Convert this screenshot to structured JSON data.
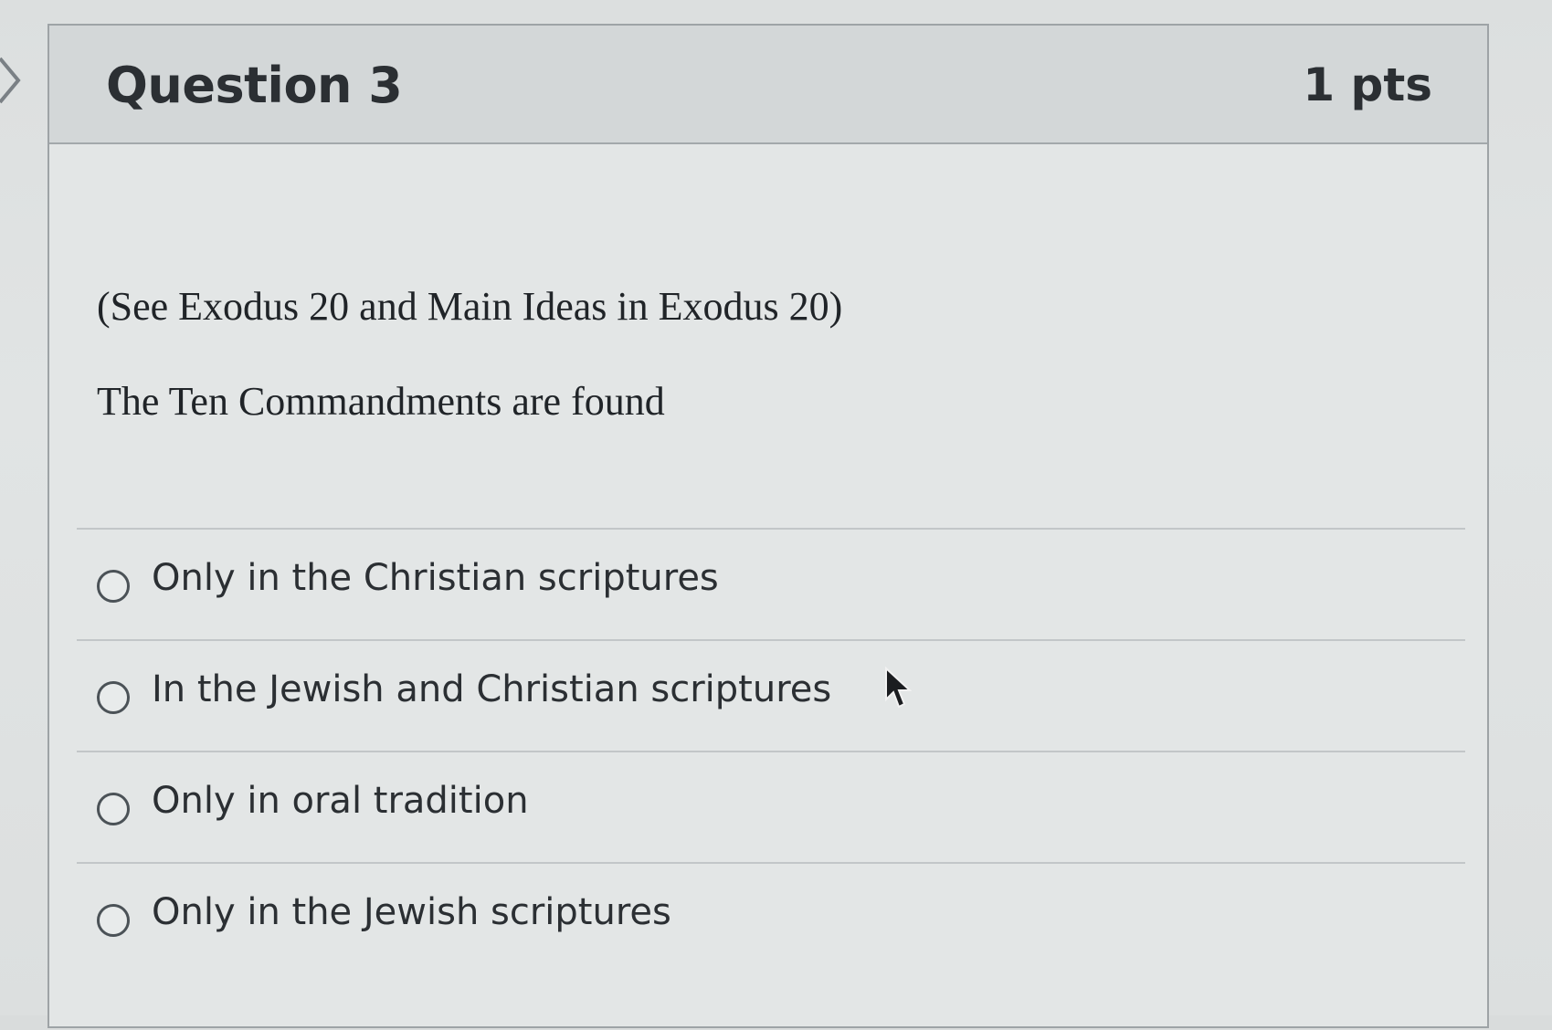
{
  "question": {
    "title": "Question 3",
    "points": "1 pts",
    "reference": "(See Exodus 20 and Main Ideas in Exodus 20)",
    "prompt": "The Ten Commandments are found"
  },
  "answers": [
    {
      "label": "Only in the Christian scriptures",
      "selected": false
    },
    {
      "label": "In the Jewish and Christian scriptures",
      "selected": false
    },
    {
      "label": "Only in oral tradition",
      "selected": false
    },
    {
      "label": "Only in the Jewish scriptures",
      "selected": false
    }
  ],
  "icons": {
    "collapse": "chevron-right-icon",
    "radio": "radio-unchecked-icon",
    "cursor": "mouse-pointer-icon"
  },
  "colors": {
    "header_bg": "#d3d7d8",
    "card_bg": "#e3e6e6",
    "text": "#2b2f33",
    "divider": "#c2c6c8"
  }
}
